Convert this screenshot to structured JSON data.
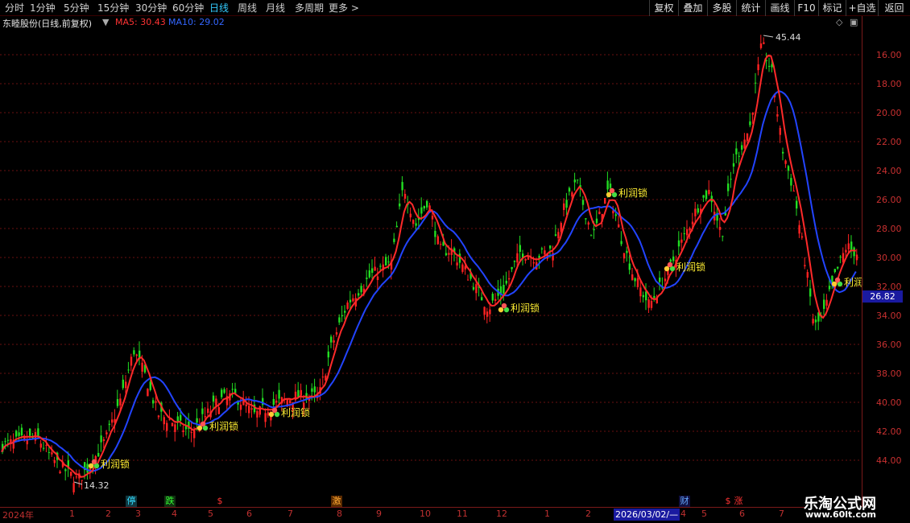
{
  "periods": [
    "分时",
    "1分钟",
    "5分钟",
    "15分钟",
    "30分钟",
    "60分钟",
    "日线",
    "周线",
    "月线",
    "多周期",
    "更多 >"
  ],
  "active_period": "日线",
  "tools": [
    "复权",
    "叠加",
    "多股",
    "统计",
    "画线",
    "F10",
    "标记",
    "+自选",
    "返回"
  ],
  "stock": {
    "name": "东睦股份(日线,前复权)",
    "ma5_label": "MA5: 30.43",
    "ma10_label": "MA10: 29.02"
  },
  "y_axis": {
    "labels": [
      "44.00",
      "42.00",
      "40.00",
      "38.00",
      "36.00",
      "34.00",
      "32.00",
      "30.00",
      "28.00",
      "26.00",
      "24.00",
      "22.00",
      "20.00",
      "18.00",
      "16.00"
    ]
  },
  "current_price_tag": "26.82",
  "annotations": {
    "high": "45.44",
    "low": "14.32"
  },
  "signal_label": "利润锁",
  "signal_label_truncated": "利润",
  "date_axis": {
    "labels": [
      "2024年",
      "1",
      "2",
      "3",
      "4",
      "5",
      "6",
      "7",
      "8",
      "9",
      "10",
      "11",
      "12",
      "1",
      "2",
      "4",
      "5",
      "6",
      "7"
    ],
    "cursor_date": "2026/03/02/—"
  },
  "event_markers": [
    "停",
    "跌",
    "$",
    "激",
    "财",
    "$",
    "涨"
  ],
  "colors": {
    "background": "#000000",
    "up": "#ff2222",
    "down": "#22dd22",
    "ma5": "#ff3333",
    "ma10": "#2244ff",
    "grid": "#6a1010",
    "signal_text": "#ffee33"
  },
  "chart_data": {
    "type": "candlestick",
    "series": [
      {
        "name": "MA5"
      },
      {
        "name": "MA10"
      }
    ],
    "ylim": [
      14,
      46
    ],
    "y_ticks": [
      16,
      18,
      20,
      22,
      24,
      26,
      28,
      30,
      32,
      34,
      36,
      38,
      40,
      42,
      44
    ],
    "high": 45.44,
    "low": 14.32,
    "last": 26.82
  },
  "branding": {
    "name": "乐淘公式网",
    "url": "www.60lt.com"
  }
}
